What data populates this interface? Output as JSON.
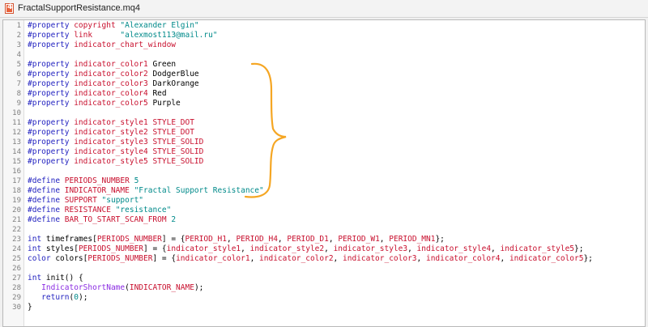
{
  "window": {
    "title": "FractalSupportResistance.mq4",
    "icon": "mq4-file-icon",
    "icon_letter": "4"
  },
  "colors": {
    "directive": "#1f1fbf",
    "identifier": "#c8102e",
    "string": "#008a8a",
    "function": "#8a2be2",
    "annotation": "#f5a623"
  },
  "annotation": {
    "type": "hand-drawn-brace",
    "icon": "brace-annotation-icon"
  },
  "lines": [
    {
      "n": "1",
      "t": [
        [
          "#property ",
          "kw"
        ],
        [
          "copyright ",
          "red"
        ],
        [
          "\"Alexander Elgin\"",
          "str"
        ]
      ]
    },
    {
      "n": "2",
      "t": [
        [
          "#property ",
          "kw"
        ],
        [
          "link      ",
          "red"
        ],
        [
          "\"alexmost113@mail.ru\"",
          "str"
        ]
      ]
    },
    {
      "n": "3",
      "t": [
        [
          "#property ",
          "kw"
        ],
        [
          "indicator_chart_window",
          "red"
        ]
      ]
    },
    {
      "n": "4",
      "t": []
    },
    {
      "n": "5",
      "t": [
        [
          "#property ",
          "kw"
        ],
        [
          "indicator_color1 ",
          "red"
        ],
        [
          "Green",
          "blk"
        ]
      ]
    },
    {
      "n": "6",
      "t": [
        [
          "#property ",
          "kw"
        ],
        [
          "indicator_color2 ",
          "red"
        ],
        [
          "DodgerBlue",
          "blk"
        ]
      ]
    },
    {
      "n": "7",
      "t": [
        [
          "#property ",
          "kw"
        ],
        [
          "indicator_color3 ",
          "red"
        ],
        [
          "DarkOrange",
          "blk"
        ]
      ]
    },
    {
      "n": "8",
      "t": [
        [
          "#property ",
          "kw"
        ],
        [
          "indicator_color4 ",
          "red"
        ],
        [
          "Red",
          "blk"
        ]
      ]
    },
    {
      "n": "9",
      "t": [
        [
          "#property ",
          "kw"
        ],
        [
          "indicator_color5 ",
          "red"
        ],
        [
          "Purple",
          "blk"
        ]
      ]
    },
    {
      "n": "10",
      "t": []
    },
    {
      "n": "11",
      "t": [
        [
          "#property ",
          "kw"
        ],
        [
          "indicator_style1 ",
          "red"
        ],
        [
          "STYLE_DOT",
          "red"
        ]
      ]
    },
    {
      "n": "12",
      "t": [
        [
          "#property ",
          "kw"
        ],
        [
          "indicator_style2 ",
          "red"
        ],
        [
          "STYLE_DOT",
          "red"
        ]
      ]
    },
    {
      "n": "13",
      "t": [
        [
          "#property ",
          "kw"
        ],
        [
          "indicator_style3 ",
          "red"
        ],
        [
          "STYLE_SOLID",
          "red"
        ]
      ]
    },
    {
      "n": "14",
      "t": [
        [
          "#property ",
          "kw"
        ],
        [
          "indicator_style4 ",
          "red"
        ],
        [
          "STYLE_SOLID",
          "red"
        ]
      ]
    },
    {
      "n": "15",
      "t": [
        [
          "#property ",
          "kw"
        ],
        [
          "indicator_style5 ",
          "red"
        ],
        [
          "STYLE_SOLID",
          "red"
        ]
      ]
    },
    {
      "n": "16",
      "t": []
    },
    {
      "n": "17",
      "t": [
        [
          "#define ",
          "kw"
        ],
        [
          "PERIODS_NUMBER ",
          "red"
        ],
        [
          "5",
          "str"
        ]
      ]
    },
    {
      "n": "18",
      "t": [
        [
          "#define ",
          "kw"
        ],
        [
          "INDICATOR_NAME ",
          "red"
        ],
        [
          "\"Fractal Support Resistance\"",
          "str"
        ]
      ]
    },
    {
      "n": "19",
      "t": [
        [
          "#define ",
          "kw"
        ],
        [
          "SUPPORT ",
          "red"
        ],
        [
          "\"support\"",
          "str"
        ]
      ]
    },
    {
      "n": "20",
      "t": [
        [
          "#define ",
          "kw"
        ],
        [
          "RESISTANCE ",
          "red"
        ],
        [
          "\"resistance\"",
          "str"
        ]
      ]
    },
    {
      "n": "21",
      "t": [
        [
          "#define ",
          "kw"
        ],
        [
          "BAR_TO_START_SCAN_FROM ",
          "red"
        ],
        [
          "2",
          "str"
        ]
      ]
    },
    {
      "n": "22",
      "t": []
    },
    {
      "n": "23",
      "t": [
        [
          "int ",
          "kw"
        ],
        [
          "timeframes[",
          "blk"
        ],
        [
          "PERIODS_NUMBER",
          "red"
        ],
        [
          "] = {",
          "blk"
        ],
        [
          "PERIOD_H1",
          "red"
        ],
        [
          ", ",
          "blk"
        ],
        [
          "PERIOD_H4",
          "red"
        ],
        [
          ", ",
          "blk"
        ],
        [
          "PERIOD_D1",
          "red"
        ],
        [
          ", ",
          "blk"
        ],
        [
          "PERIOD_W1",
          "red"
        ],
        [
          ", ",
          "blk"
        ],
        [
          "PERIOD_MN1",
          "red"
        ],
        [
          "};",
          "blk"
        ]
      ]
    },
    {
      "n": "24",
      "t": [
        [
          "int ",
          "kw"
        ],
        [
          "styles[",
          "blk"
        ],
        [
          "PERIODS_NUMBER",
          "red"
        ],
        [
          "] = {",
          "blk"
        ],
        [
          "indicator_style1",
          "red"
        ],
        [
          ", ",
          "blk"
        ],
        [
          "indicator_style2",
          "red"
        ],
        [
          ", ",
          "blk"
        ],
        [
          "indicator_style3",
          "red"
        ],
        [
          ", ",
          "blk"
        ],
        [
          "indicator_style4",
          "red"
        ],
        [
          ", ",
          "blk"
        ],
        [
          "indicator_style5",
          "red"
        ],
        [
          "};",
          "blk"
        ]
      ]
    },
    {
      "n": "25",
      "t": [
        [
          "color ",
          "kw"
        ],
        [
          "colors[",
          "blk"
        ],
        [
          "PERIODS_NUMBER",
          "red"
        ],
        [
          "] = {",
          "blk"
        ],
        [
          "indicator_color1",
          "red"
        ],
        [
          ", ",
          "blk"
        ],
        [
          "indicator_color2",
          "red"
        ],
        [
          ", ",
          "blk"
        ],
        [
          "indicator_color3",
          "red"
        ],
        [
          ", ",
          "blk"
        ],
        [
          "indicator_color4",
          "red"
        ],
        [
          ", ",
          "blk"
        ],
        [
          "indicator_color5",
          "red"
        ],
        [
          "};",
          "blk"
        ]
      ]
    },
    {
      "n": "26",
      "t": []
    },
    {
      "n": "27",
      "t": [
        [
          "int ",
          "kw"
        ],
        [
          "init",
          "blk"
        ],
        [
          "() {",
          "blk"
        ]
      ]
    },
    {
      "n": "28",
      "t": [
        [
          "   ",
          "blk"
        ],
        [
          "IndicatorShortName",
          "fn"
        ],
        [
          "(",
          "blk"
        ],
        [
          "INDICATOR_NAME",
          "red"
        ],
        [
          ");",
          "blk"
        ]
      ]
    },
    {
      "n": "29",
      "t": [
        [
          "   ",
          "blk"
        ],
        [
          "return",
          "kw"
        ],
        [
          "(",
          "blk"
        ],
        [
          "0",
          "str"
        ],
        [
          ");",
          "blk"
        ]
      ]
    },
    {
      "n": "30",
      "t": [
        [
          "}",
          "blk"
        ]
      ]
    }
  ]
}
